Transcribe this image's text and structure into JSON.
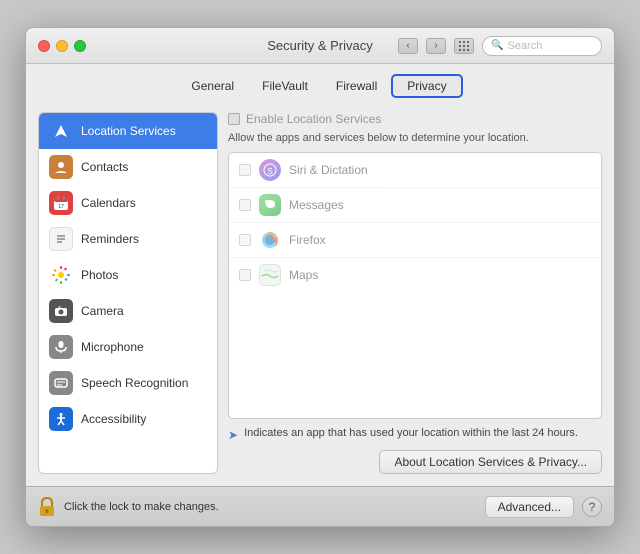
{
  "window": {
    "title": "Security & Privacy"
  },
  "titlebar": {
    "search_placeholder": "Search",
    "nav_back": "‹",
    "nav_fwd": "›",
    "grid": "⠿"
  },
  "tabs": [
    {
      "label": "General",
      "active": false
    },
    {
      "label": "FileVault",
      "active": false
    },
    {
      "label": "Firewall",
      "active": false
    },
    {
      "label": "Privacy",
      "active": true
    }
  ],
  "sidebar": {
    "items": [
      {
        "label": "Location Services",
        "icon": "location"
      },
      {
        "label": "Contacts",
        "icon": "contacts"
      },
      {
        "label": "Calendars",
        "icon": "calendars"
      },
      {
        "label": "Reminders",
        "icon": "reminders"
      },
      {
        "label": "Photos",
        "icon": "photos"
      },
      {
        "label": "Camera",
        "icon": "camera"
      },
      {
        "label": "Microphone",
        "icon": "microphone"
      },
      {
        "label": "Speech Recognition",
        "icon": "speech"
      },
      {
        "label": "Accessibility",
        "icon": "accessibility"
      }
    ]
  },
  "main": {
    "enable_label": "Enable Location Services",
    "allow_text": "Allow the apps and services below to determine your location.",
    "apps": [
      {
        "name": "Siri & Dictation",
        "icon": "siri"
      },
      {
        "name": "Messages",
        "icon": "messages"
      },
      {
        "name": "Firefox",
        "icon": "firefox"
      },
      {
        "name": "Maps",
        "icon": "maps"
      }
    ],
    "note_text": "Indicates an app that has used your location within the last 24 hours.",
    "about_button": "About Location Services & Privacy..."
  },
  "bottom": {
    "lock_text": "Click the lock to make changes.",
    "advanced_button": "Advanced...",
    "help_label": "?"
  }
}
